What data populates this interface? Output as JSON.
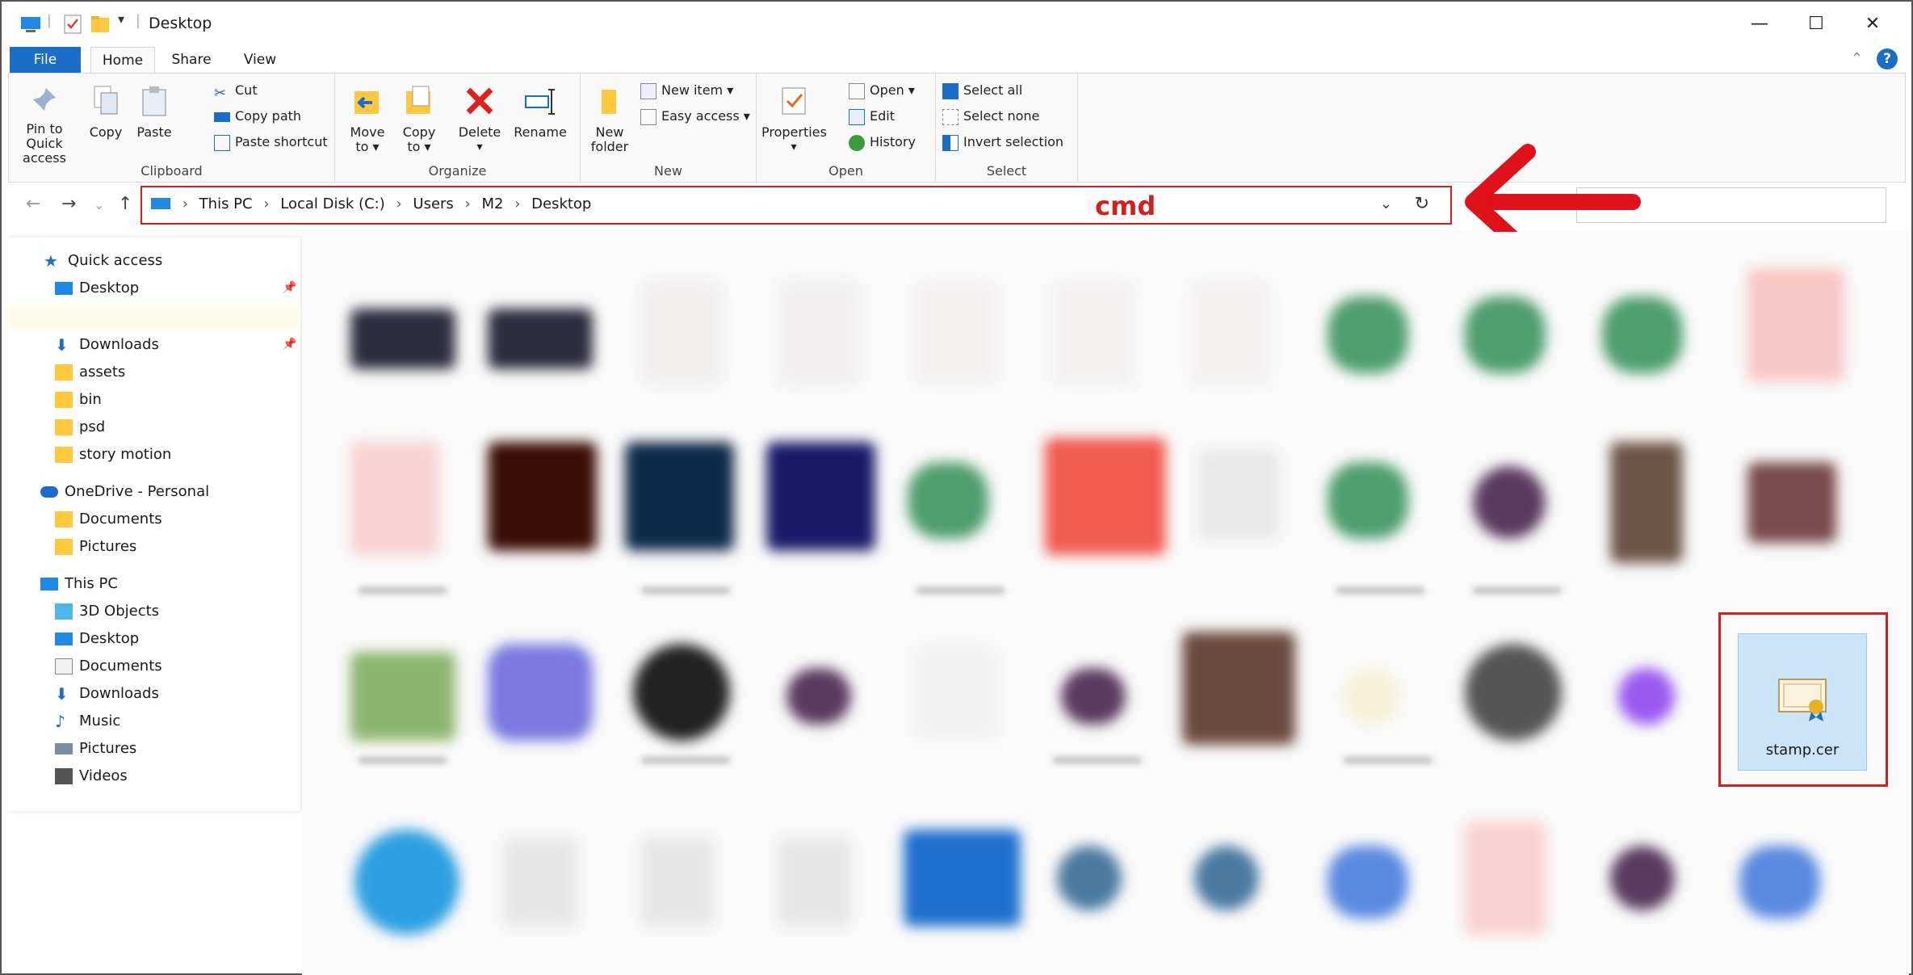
{
  "window": {
    "title": "Desktop"
  },
  "tabs": [
    "File",
    "Home",
    "Share",
    "View"
  ],
  "ribbon": {
    "clipboard": {
      "label": "Clipboard",
      "pin_line1": "Pin to Quick",
      "pin_line2": "access",
      "copy": "Copy",
      "paste": "Paste",
      "cut": "Cut",
      "copy_path": "Copy path",
      "paste_shortcut": "Paste shortcut"
    },
    "organize": {
      "label": "Organize",
      "move_to_1": "Move",
      "move_to_2": "to ▾",
      "copy_to_1": "Copy",
      "copy_to_2": "to ▾",
      "delete": "Delete",
      "rename": "Rename"
    },
    "new": {
      "label": "New",
      "new_folder_1": "New",
      "new_folder_2": "folder",
      "new_item": "New item ▾",
      "easy_access": "Easy access ▾"
    },
    "open": {
      "label": "Open",
      "properties": "Properties",
      "open": "Open ▾",
      "edit": "Edit",
      "history": "History"
    },
    "select": {
      "label": "Select",
      "select_all": "Select all",
      "select_none": "Select none",
      "invert": "Invert selection"
    }
  },
  "address": {
    "crumbs": [
      "This PC",
      "Local Disk (C:)",
      "Users",
      "M2",
      "Desktop"
    ],
    "annotation": "cmd"
  },
  "navpane": {
    "quick_access": "Quick access",
    "qa_items": [
      "Desktop",
      "Downloads",
      "assets",
      "bin",
      "psd",
      "story motion"
    ],
    "onedrive": "OneDrive - Personal",
    "od_items": [
      "Documents",
      "Pictures"
    ],
    "this_pc": "This PC",
    "pc_items": [
      "3D Objects",
      "Desktop",
      "Documents",
      "Downloads",
      "Music",
      "Pictures",
      "Videos"
    ]
  },
  "selected_file": {
    "name": "stamp.cer"
  },
  "colors": {
    "accent": "#1c6dc9",
    "annotation": "#d21f1f",
    "selection": "#cce4f7"
  }
}
